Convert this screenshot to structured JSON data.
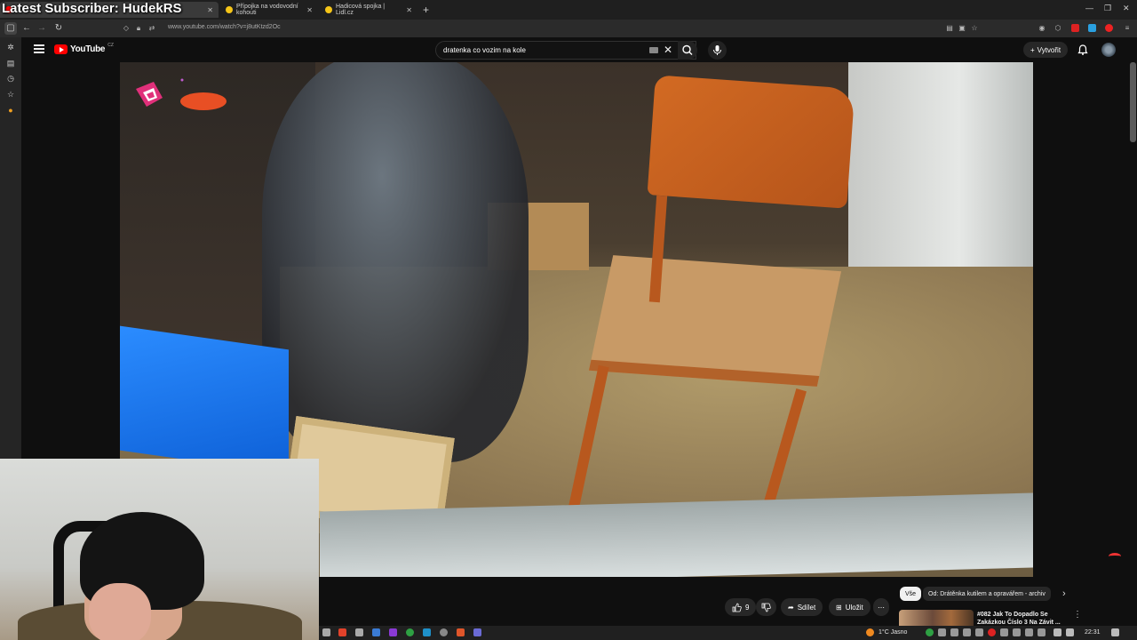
{
  "overlay": {
    "title": "Latest Subscriber: HudekRS"
  },
  "browser": {
    "tabs": [
      {
        "label": "",
        "active": true
      },
      {
        "label": "Přípojka na vodovodní kohouti"
      },
      {
        "label": "Hadicová spojka | Lidl.cz"
      }
    ],
    "url": "www.youtube.com/watch?v=j8utKtzd2Oc",
    "new_tab": "+"
  },
  "youtube": {
    "logo_text": "YouTube",
    "country_code": "CZ",
    "search_value": "dratenka co vozim na kole",
    "create_label": "Vytvořit",
    "actions": {
      "like_count": "9",
      "share_label": "Sdílet",
      "save_label": "Uložit"
    },
    "chips": {
      "all": "Vše",
      "from_channel": "Od: Drátěnka kutilem a opravářem - archiv"
    },
    "recommendation": {
      "title": "#082 Jak To Dopadlo Se Zakázkou Číslo 3 Na Závit ..."
    }
  },
  "taskbar": {
    "weather": "1°C  Jasno",
    "time": "22:31"
  },
  "colors": {
    "brand_red": "#ff0000",
    "accent_orange": "#d26a23",
    "bin_blue": "#1f7ef0"
  }
}
